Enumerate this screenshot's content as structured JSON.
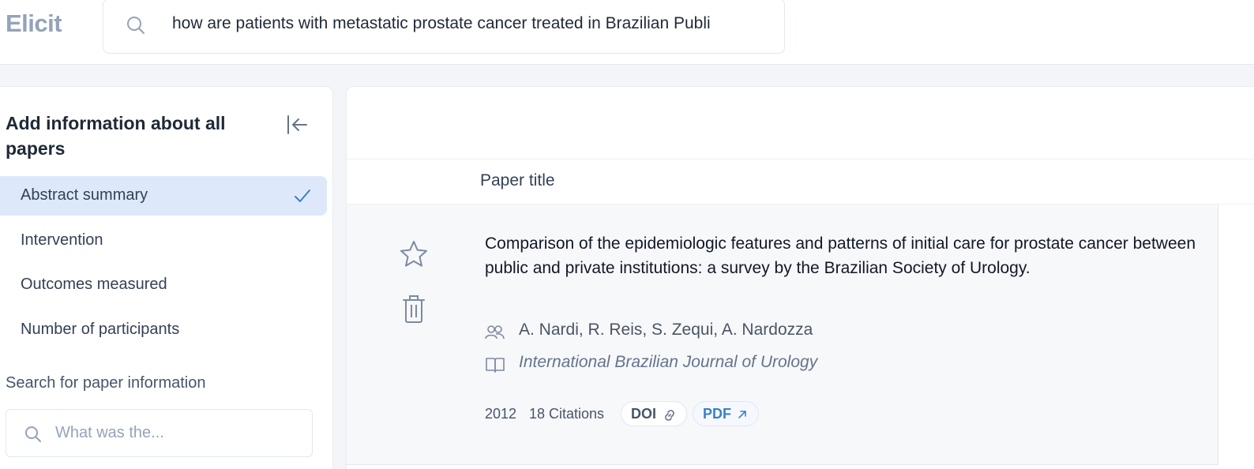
{
  "app": {
    "logo": "Elicit"
  },
  "search": {
    "query": "how are patients with metastatic prostate cancer treated in Brazilian Publi"
  },
  "sidebar": {
    "title": "Add information about all papers",
    "columns": [
      {
        "label": "Abstract summary",
        "selected": true
      },
      {
        "label": "Intervention",
        "selected": false
      },
      {
        "label": "Outcomes measured",
        "selected": false
      },
      {
        "label": "Number of participants",
        "selected": false
      }
    ],
    "search_label": "Search for paper information",
    "search_placeholder": "What was the..."
  },
  "table": {
    "header": "Paper title",
    "rows": [
      {
        "title": "Comparison of the epidemiologic features and patterns of initial care for prostate cancer between public and private institutions: a survey by the Brazilian Society of Urology.",
        "authors": "A. Nardi, R. Reis, S. Zequi, A. Nardozza",
        "journal": "International Brazilian Journal of Urology",
        "year": "2012",
        "citations": "18 Citations",
        "doi_label": "DOI",
        "pdf_label": "PDF"
      }
    ]
  },
  "colors": {
    "accent": "#3b82c4",
    "selected_bg": "#dde9fb",
    "logo": "#94a3b8"
  }
}
